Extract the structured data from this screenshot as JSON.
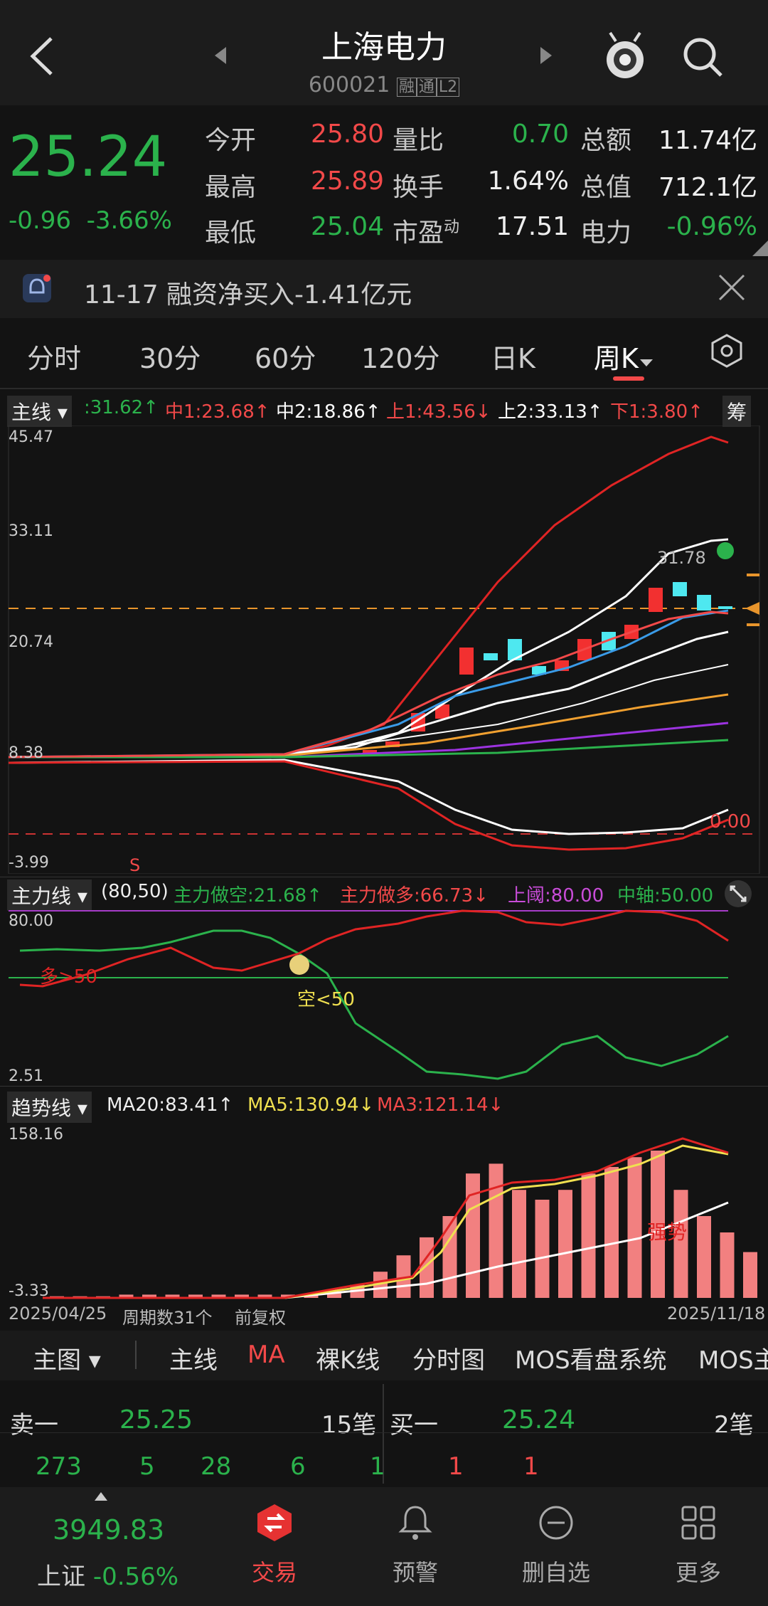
{
  "header": {
    "title": "上海电力",
    "code": "600021",
    "badges": [
      "融",
      "通",
      "L2"
    ]
  },
  "quote": {
    "price": "25.24",
    "change": "-0.96",
    "pct": "-3.66%",
    "rows": [
      [
        "今开",
        "25.80",
        "量比",
        "0.70",
        "总额",
        "11.74亿"
      ],
      [
        "最高",
        "25.89",
        "换手",
        "1.64%",
        "总值",
        "712.1亿"
      ],
      [
        "最低",
        "25.04",
        "市盈",
        "17.51",
        "电力",
        "-0.96%"
      ]
    ],
    "pe_suffix": "动"
  },
  "notice": {
    "text": "11-17 融资净买入-1.41亿元"
  },
  "tabs": [
    "分时",
    "30分",
    "60分",
    "120分",
    "日K",
    "周K"
  ],
  "main": {
    "label": "主线",
    "chips": [
      ":31.62↑",
      "中1:23.68↑",
      "中2:18.86↑",
      "上1:43.56↓",
      "上2:33.13↑",
      "下1:3.80↑"
    ],
    "extra": "筹",
    "axis": [
      "45.47",
      "33.11",
      "20.74",
      "8.38",
      "-3.99"
    ],
    "zero": "0.00",
    "price_tag": "31.78",
    "sig_s": "S"
  },
  "mainforce": {
    "label": "主力线",
    "params": "(80,50)",
    "short": "主力做空:21.68↑",
    "long": "主力做多:66.73↓",
    "upper": "上阈:80.00",
    "mid": "中轴:50.00",
    "axis": [
      "80.00",
      "2.51"
    ],
    "note_long": "多>50",
    "note_short": "空<50"
  },
  "trend": {
    "label": "趋势线",
    "ma20": "MA20:83.41↑",
    "ma5": "MA5:130.94↓",
    "ma3": "MA3:121.14↓",
    "axis": [
      "158.16",
      "-3.33"
    ],
    "note": "强势",
    "bars": [
      1,
      1,
      1,
      2,
      2,
      2,
      2,
      2,
      2,
      2,
      2,
      2,
      4,
      8,
      16,
      26,
      37,
      50,
      76,
      82,
      66,
      60,
      66,
      76,
      80,
      86,
      90,
      66,
      50,
      40,
      28
    ]
  },
  "footer_info": {
    "start": "2025/04/25",
    "periods": "周期数31个",
    "adj": "前复权",
    "end": "2025/11/18"
  },
  "menu": [
    "主图",
    "主线",
    "MA",
    "裸K线",
    "分时图",
    "MOS看盘系统",
    "MOS主"
  ],
  "order": {
    "sell_label": "卖一",
    "sell_price": "25.25",
    "sell_count": "15笔",
    "buy_label": "买一",
    "buy_price": "25.24",
    "buy_count": "2笔",
    "sell_vols": [
      "273",
      "5",
      "28",
      "6",
      "1"
    ],
    "buy_vols": [
      "1",
      "1"
    ]
  },
  "bottom": {
    "index_val": "3949.83",
    "index_name": "上证",
    "index_pct": "-0.56%",
    "nav": [
      "交易",
      "预警",
      "删自选",
      "更多"
    ]
  },
  "chart_data": {
    "type": "line",
    "title": "",
    "series": [
      {
        "name": "",
        "values": []
      }
    ]
  }
}
